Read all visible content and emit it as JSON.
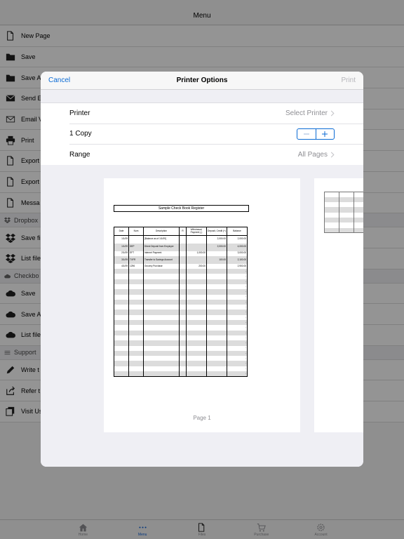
{
  "header": {
    "title": "Menu"
  },
  "menu": [
    {
      "label": "New Page",
      "icon": "file-icon",
      "type": "item"
    },
    {
      "label": "Save",
      "icon": "folder-icon",
      "type": "item"
    },
    {
      "label": "Save A",
      "icon": "folder-icon",
      "type": "item"
    },
    {
      "label": "Send E",
      "icon": "mail-icon",
      "type": "item"
    },
    {
      "label": "Email V",
      "icon": "mail-outline-icon",
      "type": "item"
    },
    {
      "label": "Print",
      "icon": "printer-icon",
      "type": "item"
    },
    {
      "label": "Export",
      "icon": "file-icon",
      "type": "item"
    },
    {
      "label": "Export",
      "icon": "file-icon",
      "type": "item"
    },
    {
      "label": "Messa",
      "icon": "file-icon",
      "type": "item"
    },
    {
      "label": "Dropbox",
      "icon": "dropbox-icon",
      "type": "section"
    },
    {
      "label": "Save fi",
      "icon": "dropbox-icon",
      "type": "item"
    },
    {
      "label": "List file",
      "icon": "dropbox-icon",
      "type": "item"
    },
    {
      "label": "Checkbo",
      "icon": "cloud-icon",
      "type": "section"
    },
    {
      "label": "Save",
      "icon": "cloud-icon",
      "type": "item"
    },
    {
      "label": "Save A",
      "icon": "cloud-icon",
      "type": "item"
    },
    {
      "label": "List file",
      "icon": "cloud-icon",
      "type": "item"
    },
    {
      "label": "Support",
      "icon": "list-icon",
      "type": "section"
    },
    {
      "label": "Write t",
      "icon": "pencil-icon",
      "type": "item"
    },
    {
      "label": "Refer t",
      "icon": "share-icon",
      "type": "item"
    },
    {
      "label": "Visit Us",
      "icon": "copy-icon",
      "type": "item"
    }
  ],
  "tabs": [
    {
      "label": "Home",
      "icon": "home-icon",
      "active": false
    },
    {
      "label": "Menu",
      "icon": "more-icon",
      "active": true
    },
    {
      "label": "Files",
      "icon": "file-icon",
      "active": false
    },
    {
      "label": "Purchase",
      "icon": "cart-icon",
      "active": false
    },
    {
      "label": "Account",
      "icon": "gear-icon",
      "active": false
    }
  ],
  "modal": {
    "title": "Printer Options",
    "cancel_label": "Cancel",
    "print_label": "Print",
    "printer_label": "Printer",
    "printer_value": "Select Printer",
    "copies_label": "1 Copy",
    "range_label": "Range",
    "range_value": "All Pages",
    "page_label": "Page 1"
  },
  "register": {
    "title": "Sample Check Book Register",
    "headers": [
      "Date",
      "Num",
      "Description",
      "R",
      "Withdrawal, Payment (-)",
      "Deposit, Credit (+)",
      "Balance"
    ],
    "rows": [
      [
        "1/1/09",
        "",
        "[Balance as of 1/1/09]",
        "",
        "",
        "2,000.00",
        "2,000.00"
      ],
      [
        "1/1/09",
        "DEP",
        "Direct Deposit from Employer",
        "",
        "",
        "2,000.00",
        "4,000.00"
      ],
      [
        "2/1/09",
        "EFT",
        "Internet Payment",
        "",
        "1,000.00",
        "",
        "3,000.00"
      ],
      [
        "3/1/09",
        "TXFR",
        "Transfer to Savings Account",
        "",
        "",
        "100.00",
        "2,100.00"
      ],
      [
        "4/1/09",
        "1296",
        "Grocery Purchase",
        "",
        "200.00",
        "",
        "2,900.00"
      ]
    ],
    "empty_row_balance": "-",
    "empty_rows": 21
  },
  "colors": {
    "accent": "#0a6ad4",
    "disabled": "#b5b5ba",
    "secondary_text": "#8e8e93"
  }
}
